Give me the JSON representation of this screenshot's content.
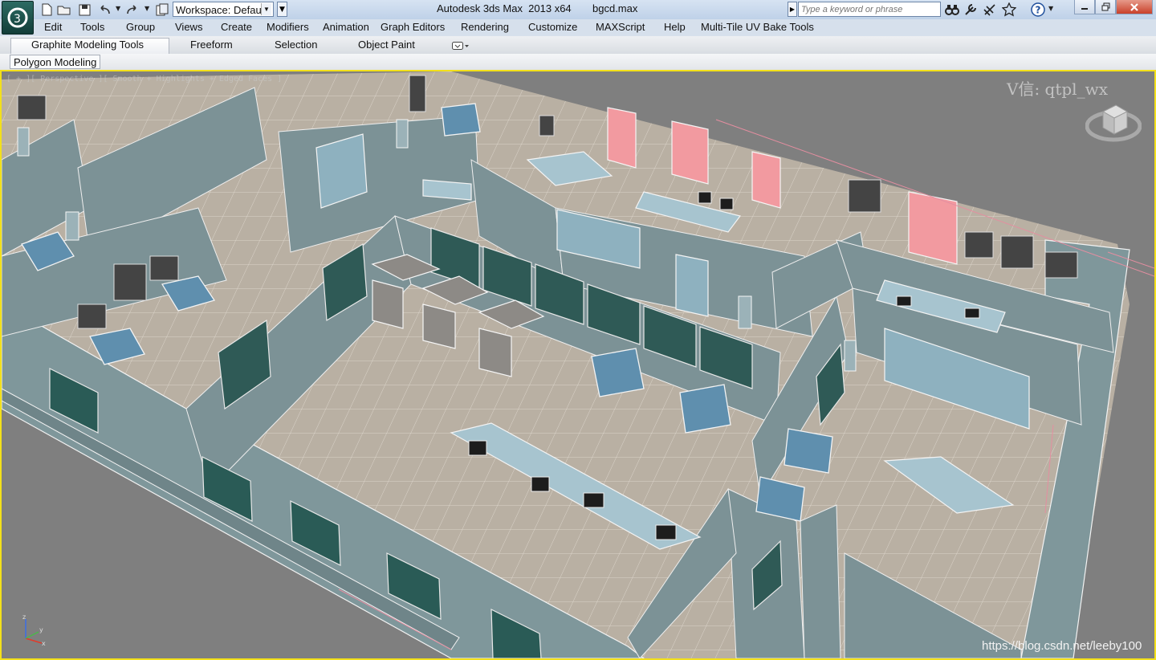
{
  "titlebar": {
    "workspace_label": "Workspace: Default",
    "app_title": "Autodesk 3ds Max  2013 x64",
    "file_name": "bgcd.max",
    "search_placeholder": "Type a keyword or phrase"
  },
  "menu": [
    "Edit",
    "Tools",
    "Group",
    "Views",
    "Create",
    "Modifiers",
    "Animation",
    "Graph Editors",
    "Rendering",
    "Customize",
    "MAXScript",
    "Help",
    "Multi-Tile UV Bake Tools"
  ],
  "ribbon": {
    "tabs": [
      "Graphite Modeling Tools",
      "Freeform",
      "Selection",
      "Object Paint"
    ],
    "active_tab": "Graphite Modeling Tools",
    "panel": "Polygon Modeling"
  },
  "viewport": {
    "label": "[ + ][ Perspective ][ Smooth + Highlights + Edged Faces ]",
    "watermark": "V信: qtpl_wx",
    "credit": "https://blog.csdn.net/leeby100",
    "axis": {
      "x": "x",
      "y": "y",
      "z": "z"
    }
  },
  "colors": {
    "accent_border": "#f3e01a",
    "wall": "#7c9296",
    "floor": "#b7ada0",
    "glass": "#2f5a56",
    "furniture": "#5e8aa6",
    "pink_window": "#f29aa0"
  },
  "icons": [
    "app-logo-icon",
    "new-file-icon",
    "open-file-icon",
    "save-icon",
    "undo-icon",
    "redo-icon",
    "project-folder-icon",
    "binoculars-icon",
    "tools-icon",
    "satellite-icon",
    "star-icon",
    "help-icon",
    "minimize-icon",
    "restore-icon",
    "close-icon",
    "viewcube-icon"
  ]
}
